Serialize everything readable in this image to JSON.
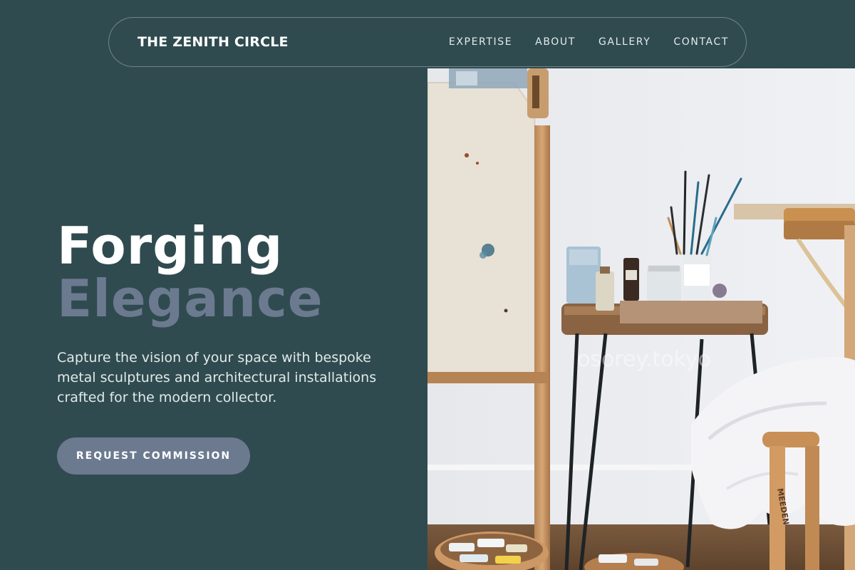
{
  "nav": {
    "brand": "THE ZENITH CIRCLE",
    "links": [
      "EXPERTISE",
      "ABOUT",
      "GALLERY",
      "CONTACT"
    ]
  },
  "hero": {
    "headline_line1": "Forging",
    "headline_line2": "Elegance",
    "lead": "Capture the vision of your space with bespoke metal sculptures and architectural installations crafted for the modern collector.",
    "cta_label": "REQUEST COMMISSION"
  },
  "image": {
    "subject": "artist studio with easel, small wooden side table holding brush jars and paint bottles, white cloth draped on a wooden stool",
    "watermark": "osorey.tokyo",
    "stool_brand": "MEEDEN"
  },
  "colors": {
    "background": "#2f4b4f",
    "accent": "#6c7a90",
    "text": "#ffffff"
  }
}
